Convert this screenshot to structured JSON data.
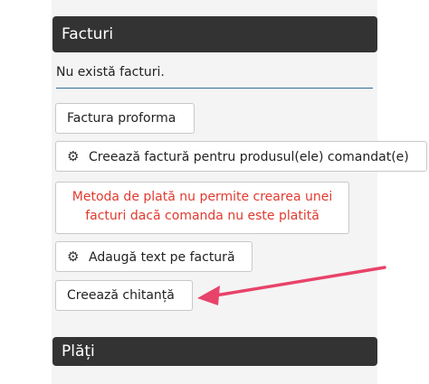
{
  "invoices": {
    "header": "Facturi",
    "empty_text": "Nu există facturi.",
    "proforma_button": "Factura proforma",
    "create_invoice_button": "Creează factură pentru produsul(ele) comandat(e)",
    "warning_line1": "Metoda de plată nu permite crearea unei",
    "warning_line2": "facturi dacă comanda nu este platită",
    "add_text_button": "Adaugă text pe factură",
    "create_receipt_button": "Creează chitanță"
  },
  "payments": {
    "header": "Plăți"
  },
  "icons": {
    "gear": "gear-icon",
    "arrow": "red-arrow-annotation"
  },
  "colors": {
    "header_bg": "#333333",
    "warning_text": "#e03a2f",
    "arrow": "#e8436a"
  }
}
